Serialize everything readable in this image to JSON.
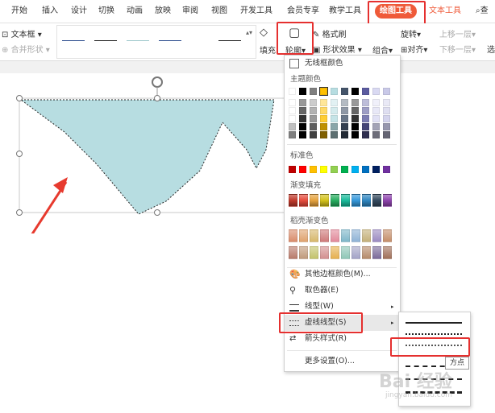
{
  "menubar": {
    "tabs": [
      "开始",
      "插入",
      "设计",
      "切换",
      "动画",
      "放映",
      "审阅",
      "视图",
      "开发工具",
      "会员专享",
      "教学工具"
    ],
    "active_tab": "绘图工具",
    "text_tools": "文本工具",
    "right_item": "查"
  },
  "toolbar": {
    "textbox": "文本框",
    "merge_shapes": "合并形状",
    "fill": "填充",
    "outline": "轮廓",
    "format_painter": "格式刷",
    "shape_effects": "形状效果",
    "group": "组合",
    "rotate": "旋转",
    "align": "对齐",
    "bring_forward": "上移一层",
    "send_backward": "下移一层",
    "select": "选"
  },
  "dropdown": {
    "no_outline": "无线框颜色",
    "theme_colors": "主题颜色",
    "standard_colors": "标准色",
    "gradient_fill": "渐变填充",
    "light_gradient": "稻壳渐变色",
    "more_colors": "其他边框颜色(M)...",
    "eyedropper": "取色器(E)",
    "line_style": "线型(W)",
    "dash_style": "虚线线型(S)",
    "arrow_style": "箭头样式(R)",
    "more_settings": "更多设置(O)..."
  },
  "colors": {
    "accent": "#ef5a39",
    "highlight_box": "#e5302f",
    "shape_fill": "#b7dde1",
    "theme_top": [
      "#ffffff",
      "#000000",
      "#7f7f7f",
      "#ffc000",
      "#b7dde1",
      "#44546a",
      "#000000",
      "#5b5b9f",
      "#d9d9f2",
      "#c9c9e8"
    ],
    "standard": [
      "#c00000",
      "#ff0000",
      "#ffc000",
      "#ffff00",
      "#92d050",
      "#00b050",
      "#00b0f0",
      "#0070c0",
      "#002060",
      "#7030a0"
    ],
    "gradient": [
      "#c0392b",
      "#e74c3c",
      "#e6a23c",
      "#d4c21a",
      "#27ae60",
      "#1abc9c",
      "#3498db",
      "#2e86c1",
      "#34495e",
      "#8e44ad"
    ],
    "light_gradient_row1": [
      "#d98c6c",
      "#e0a36f",
      "#d7b86c",
      "#cf7a7a",
      "#e28a9b",
      "#7fb7c9",
      "#8fb3d6",
      "#c4b07a",
      "#9b8bc1",
      "#c58e6a"
    ],
    "light_gradient_row2": [
      "#b87a6a",
      "#c09a7a",
      "#c3c36a",
      "#d38f8f",
      "#e6b050",
      "#8fc7b7",
      "#a3a3c7",
      "#b58a6a",
      "#7a6a9a",
      "#a0705a"
    ]
  },
  "tooltip": "方点",
  "watermark": "Bai 经验",
  "watermark_sub": "jingyan.baidu.com"
}
